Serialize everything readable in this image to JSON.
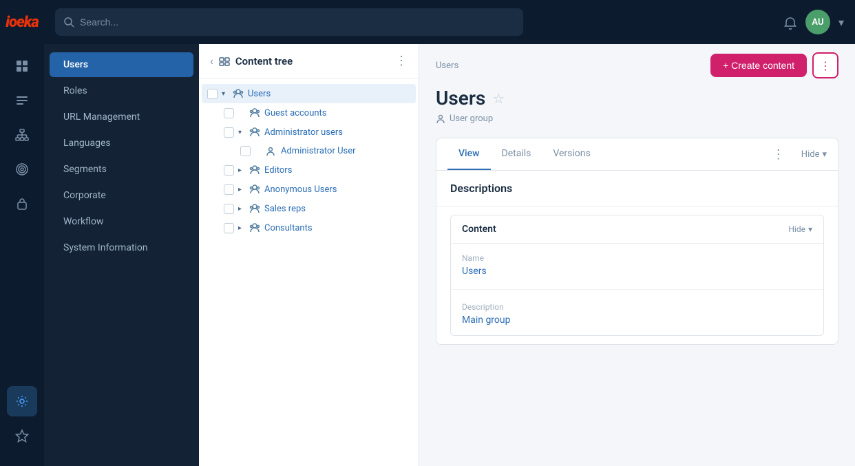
{
  "logo": {
    "text": "ioeka"
  },
  "header": {
    "search_placeholder": "Search...",
    "avatar_initials": "AU"
  },
  "icon_nav": [
    {
      "id": "grid-icon",
      "label": "Dashboard"
    },
    {
      "id": "list-icon",
      "label": "Content"
    },
    {
      "id": "hierarchy-icon",
      "label": "Structure"
    },
    {
      "id": "target-icon",
      "label": "Marketing"
    },
    {
      "id": "badge-icon",
      "label": "Permissions"
    },
    {
      "id": "gear-icon",
      "label": "Settings"
    },
    {
      "id": "star-icon",
      "label": "Favorites"
    }
  ],
  "left_nav": {
    "items": [
      {
        "id": "users",
        "label": "Users",
        "active": true
      },
      {
        "id": "roles",
        "label": "Roles"
      },
      {
        "id": "url-management",
        "label": "URL Management"
      },
      {
        "id": "languages",
        "label": "Languages"
      },
      {
        "id": "segments",
        "label": "Segments"
      },
      {
        "id": "corporate",
        "label": "Corporate"
      },
      {
        "id": "workflow",
        "label": "Workflow"
      },
      {
        "id": "system-information",
        "label": "System Information"
      }
    ]
  },
  "tree": {
    "title": "Content tree",
    "nodes": [
      {
        "id": "users",
        "label": "Users",
        "level": 0,
        "expanded": true,
        "selected": true,
        "has_checkbox": true
      },
      {
        "id": "guest-accounts",
        "label": "Guest accounts",
        "level": 1,
        "expanded": false,
        "has_checkbox": true
      },
      {
        "id": "administrator-users",
        "label": "Administrator users",
        "level": 1,
        "expanded": true,
        "has_checkbox": true
      },
      {
        "id": "administrator-user",
        "label": "Administrator User",
        "level": 2,
        "expanded": false,
        "has_checkbox": true,
        "is_user": true
      },
      {
        "id": "editors",
        "label": "Editors",
        "level": 1,
        "expanded": false,
        "has_checkbox": true
      },
      {
        "id": "anonymous-users",
        "label": "Anonymous Users",
        "level": 1,
        "expanded": false,
        "has_checkbox": true
      },
      {
        "id": "sales-reps",
        "label": "Sales reps",
        "level": 1,
        "expanded": false,
        "has_checkbox": true
      },
      {
        "id": "consultants",
        "label": "Consultants",
        "level": 1,
        "expanded": false,
        "has_checkbox": true
      }
    ]
  },
  "detail": {
    "breadcrumb": "Users",
    "title": "Users",
    "subtitle": "User group",
    "create_content_label": "+ Create content",
    "tabs": [
      {
        "id": "view",
        "label": "View",
        "active": true
      },
      {
        "id": "details",
        "label": "Details"
      },
      {
        "id": "versions",
        "label": "Versions"
      }
    ],
    "hide_label": "Hide",
    "sections": [
      {
        "id": "descriptions",
        "title": "Descriptions",
        "content_sections": [
          {
            "id": "content",
            "title": "Content",
            "hide_label": "Hide",
            "fields": [
              {
                "id": "name",
                "label": "Name",
                "value": "Users"
              },
              {
                "id": "description",
                "label": "Description",
                "value": "Main group"
              }
            ]
          }
        ]
      }
    ]
  }
}
